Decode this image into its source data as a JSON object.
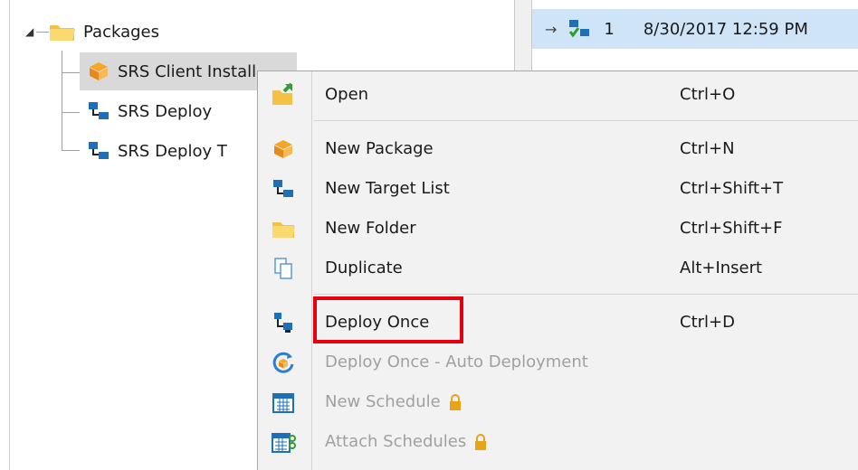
{
  "tree": {
    "expander_glyph": "◢",
    "root": {
      "label": "Packages",
      "icon": "folder-icon",
      "expanded": true
    },
    "children": [
      {
        "label": "SRS Client Install",
        "icon": "package-icon",
        "selected": true
      },
      {
        "label": "SRS Deploy",
        "icon": "target-list-icon",
        "selected": false
      },
      {
        "label": "SRS Deploy T",
        "icon": "target-list-icon",
        "selected": false
      }
    ]
  },
  "list": {
    "row": {
      "arrow": "→",
      "icon": "deployment-status-icon",
      "number": "1",
      "date": "8/30/2017 12:59 PM"
    }
  },
  "context_menu": {
    "items": [
      {
        "label": "Open",
        "shortcut": "Ctrl+O",
        "icon": "open-icon",
        "enabled": true
      },
      {
        "label": "New Package",
        "shortcut": "Ctrl+N",
        "icon": "package-icon",
        "enabled": true
      },
      {
        "label": "New Target List",
        "shortcut": "Ctrl+Shift+T",
        "icon": "target-list-icon",
        "enabled": true
      },
      {
        "label": "New Folder",
        "shortcut": "Ctrl+Shift+F",
        "icon": "folder-icon",
        "enabled": true
      },
      {
        "label": "Duplicate",
        "shortcut": "Alt+Insert",
        "icon": "duplicate-icon",
        "enabled": true
      },
      {
        "label": "Deploy Once",
        "shortcut": "Ctrl+D",
        "icon": "deploy-icon",
        "enabled": true,
        "highlighted": true
      },
      {
        "label": "Deploy Once - Auto Deployment",
        "shortcut": "",
        "icon": "auto-deploy-icon",
        "enabled": false
      },
      {
        "label": "New Schedule",
        "shortcut": "",
        "icon": "calendar-icon",
        "enabled": false,
        "locked": true
      },
      {
        "label": "Attach Schedules",
        "shortcut": "",
        "icon": "calendar-attach-icon",
        "enabled": false,
        "locked": true
      }
    ]
  },
  "colors": {
    "highlight_box": "#e5000e",
    "selection": "#d9d9d9",
    "list_row": "#cfe4f7",
    "menu_bg": "#f2f2f2",
    "disabled_text": "#a0a0a0",
    "lock": "#e8a317"
  }
}
